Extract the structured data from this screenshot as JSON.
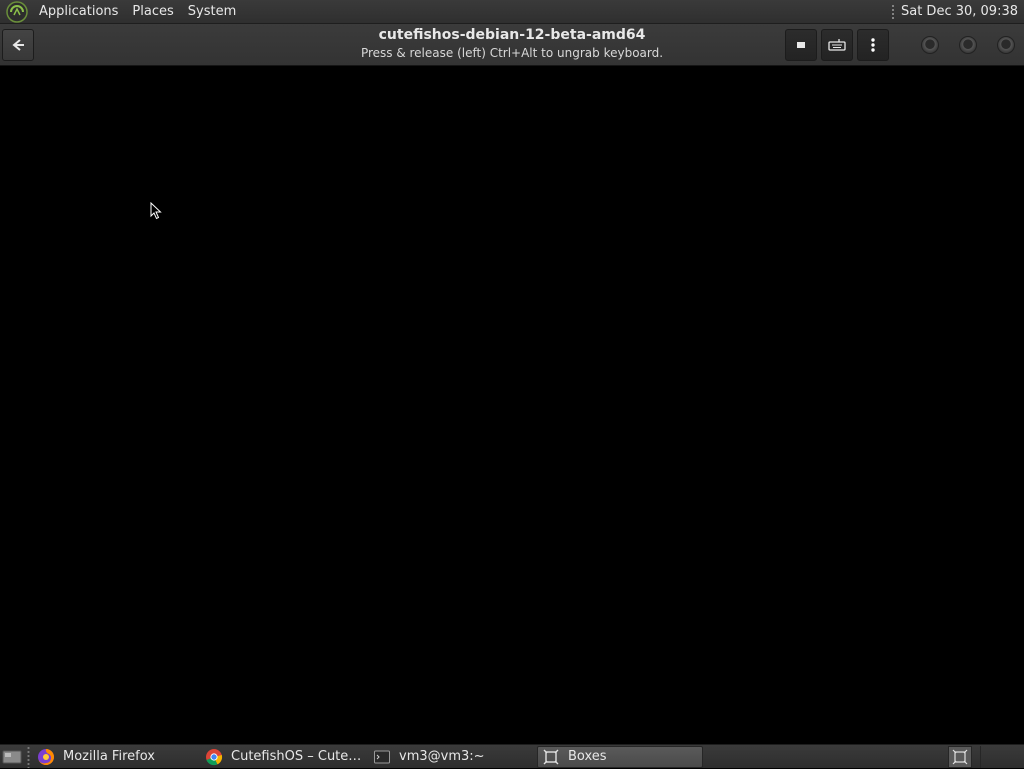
{
  "top_panel": {
    "menus": [
      "Applications",
      "Places",
      "System"
    ],
    "clock": "Sat Dec 30, 09:38",
    "logo_icon": "mate-logo-icon"
  },
  "header_bar": {
    "title": "cutefishos-debian-12-beta-amd64",
    "subtitle": "Press & release (left) Ctrl+Alt to ungrab keyboard.",
    "buttons": [
      "back-icon",
      "display-icon",
      "keyboard-icon",
      "kebab-menu-icon",
      "minimize-icon",
      "maximize-icon",
      "close-icon"
    ]
  },
  "taskbar": {
    "tasks": [
      {
        "label": "Mozilla Firefox",
        "icon": "firefox-icon",
        "active": false
      },
      {
        "label": "CutefishOS – Cutefi...",
        "icon": "chrome-icon",
        "active": false
      },
      {
        "label": "vm3@vm3:~",
        "icon": "terminal-icon",
        "active": false
      },
      {
        "label": "Boxes",
        "icon": "boxes-icon",
        "active": true
      }
    ]
  },
  "colors": {
    "panel_bg": "#333333",
    "vm_bg": "#000000",
    "text": "#e8e8e8"
  }
}
